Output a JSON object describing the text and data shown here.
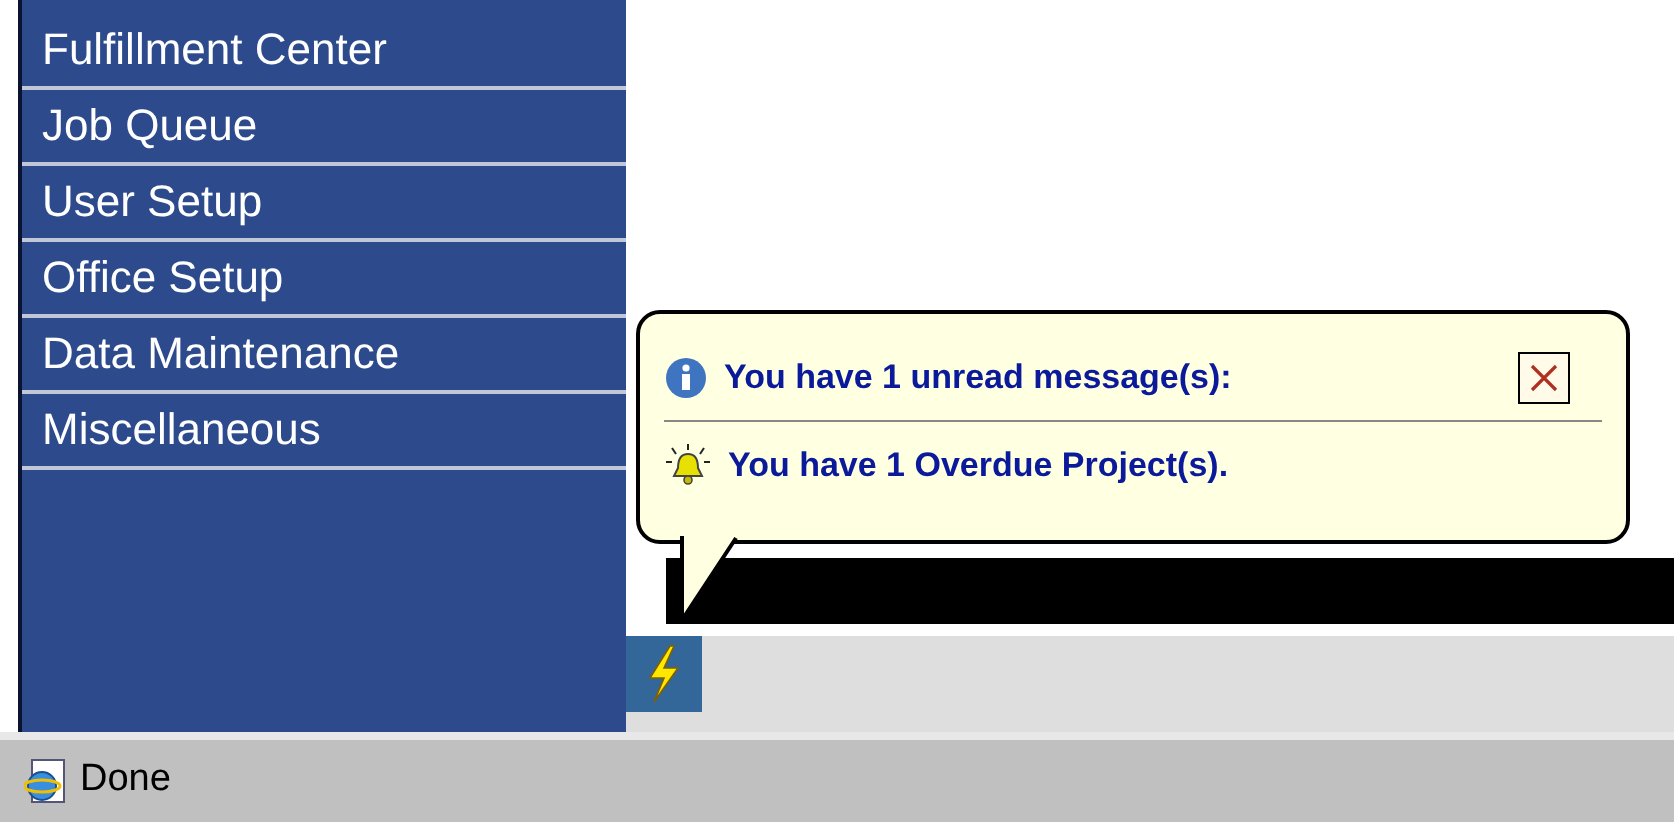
{
  "sidebar": {
    "items": [
      {
        "label": "Fulfillment Center"
      },
      {
        "label": "Job Queue"
      },
      {
        "label": "User Setup"
      },
      {
        "label": "Office Setup"
      },
      {
        "label": "Data Maintenance"
      },
      {
        "label": "Miscellaneous"
      }
    ]
  },
  "notification": {
    "messages": [
      {
        "kind": "info",
        "text": "You have 1 unread message(s):"
      },
      {
        "kind": "alert",
        "text": "You have 1 Overdue Project(s)."
      }
    ]
  },
  "status_bar": {
    "text": "Done"
  }
}
